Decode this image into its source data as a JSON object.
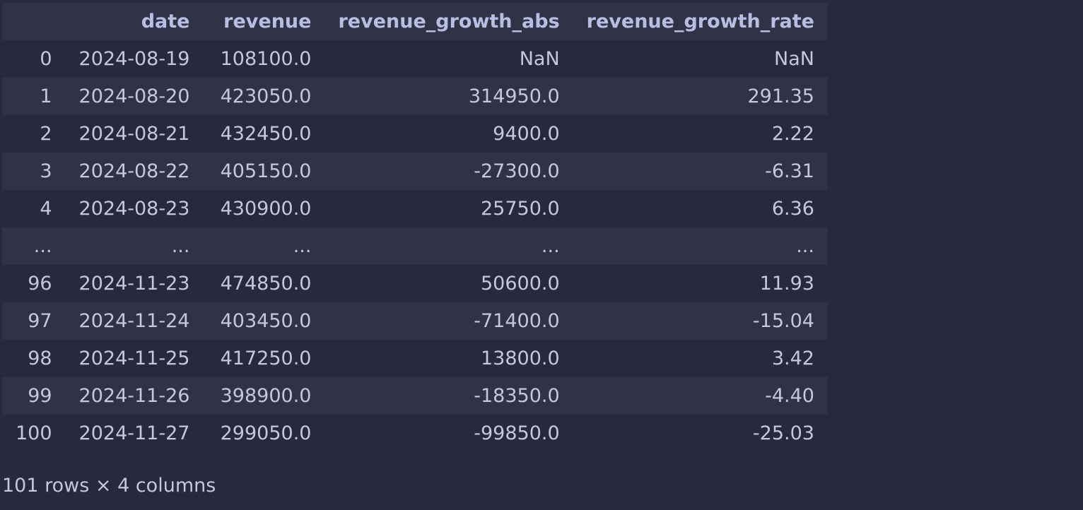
{
  "table": {
    "columns": [
      "",
      "date",
      "revenue",
      "revenue_growth_abs",
      "revenue_growth_rate"
    ],
    "rows": [
      {
        "index": "0",
        "date": "2024-08-19",
        "revenue": "108100.0",
        "abs": "NaN",
        "rate": "NaN"
      },
      {
        "index": "1",
        "date": "2024-08-20",
        "revenue": "423050.0",
        "abs": "314950.0",
        "rate": "291.35"
      },
      {
        "index": "2",
        "date": "2024-08-21",
        "revenue": "432450.0",
        "abs": "9400.0",
        "rate": "2.22"
      },
      {
        "index": "3",
        "date": "2024-08-22",
        "revenue": "405150.0",
        "abs": "-27300.0",
        "rate": "-6.31"
      },
      {
        "index": "4",
        "date": "2024-08-23",
        "revenue": "430900.0",
        "abs": "25750.0",
        "rate": "6.36"
      },
      {
        "index": "...",
        "date": "...",
        "revenue": "...",
        "abs": "...",
        "rate": "..."
      },
      {
        "index": "96",
        "date": "2024-11-23",
        "revenue": "474850.0",
        "abs": "50600.0",
        "rate": "11.93"
      },
      {
        "index": "97",
        "date": "2024-11-24",
        "revenue": "403450.0",
        "abs": "-71400.0",
        "rate": "-15.04"
      },
      {
        "index": "98",
        "date": "2024-11-25",
        "revenue": "417250.0",
        "abs": "13800.0",
        "rate": "3.42"
      },
      {
        "index": "99",
        "date": "2024-11-26",
        "revenue": "398900.0",
        "abs": "-18350.0",
        "rate": "-4.40"
      },
      {
        "index": "100",
        "date": "2024-11-27",
        "revenue": "299050.0",
        "abs": "-99850.0",
        "rate": "-25.03"
      }
    ]
  },
  "shape_text": "101 rows × 4 columns"
}
